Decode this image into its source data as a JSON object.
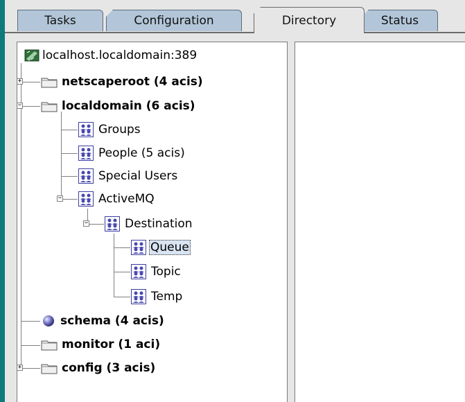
{
  "tabs": [
    {
      "label": "Tasks",
      "active": false
    },
    {
      "label": "Configuration",
      "active": false
    },
    {
      "label": "Directory",
      "active": true
    },
    {
      "label": "Status",
      "active": false
    }
  ],
  "tree": {
    "root": "localhost.localdomain:389",
    "netscaperoot": "netscaperoot  (4 acis)",
    "localdomain": "localdomain  (6 acis)",
    "groups": "Groups",
    "people": "People  (5 acis)",
    "special_users": "Special Users",
    "activemq": "ActiveMQ",
    "destination": "Destination",
    "queue": "Queue",
    "topic": "Topic",
    "temp": "Temp",
    "schema": "schema  (4 acis)",
    "monitor": "monitor  (1 aci)",
    "config": "config  (3 acis)"
  },
  "colors": {
    "background": "#0f7a7a",
    "tab_inactive": "#b3c6d9",
    "selection": "#d8e4f2"
  }
}
